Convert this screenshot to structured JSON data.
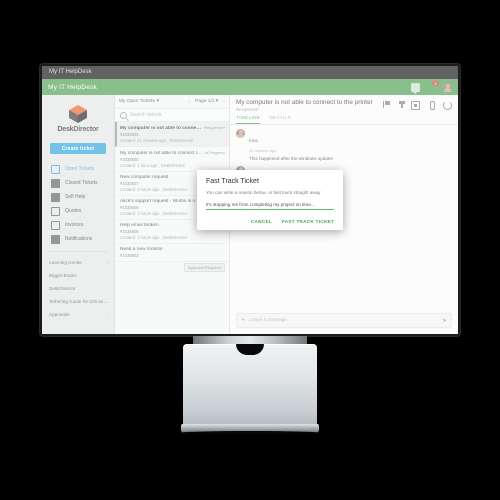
{
  "window": {
    "title": "My IT HelpDesk"
  },
  "topbar": {
    "brand": "My IT HelpDesk",
    "icons": [
      {
        "name": "chat-icon",
        "label": "Chat"
      },
      {
        "name": "bell-icon",
        "label": "Notifications",
        "badge": "3"
      },
      {
        "name": "user-avatar",
        "label": "Account"
      }
    ]
  },
  "sidebar": {
    "logo_name_1": "Desk",
    "logo_name_2": "Director",
    "create_button": "Create ticket",
    "items": [
      {
        "label": "Open Tickets",
        "icon": "inbox-icon",
        "active": true
      },
      {
        "label": "Closed Tickets",
        "icon": "archive-icon",
        "active": false
      },
      {
        "label": "Self Help",
        "icon": "book-icon",
        "active": false
      },
      {
        "label": "Quotes",
        "icon": "card-icon",
        "active": false
      },
      {
        "label": "Invoices",
        "icon": "dollar-icon",
        "active": false
      },
      {
        "label": "Notifications",
        "icon": "bell-icon",
        "active": false
      }
    ],
    "sub_items": [
      {
        "label": "Learning Center",
        "caret": "›"
      },
      {
        "label": "Bigger Brains",
        "caret": ""
      },
      {
        "label": "DeskDirector",
        "caret": ""
      },
      {
        "label": "Tethering Guide for iOS and A...",
        "caret": ""
      },
      {
        "label": "Approvals",
        "caret": "›"
      }
    ]
  },
  "ticket_list": {
    "filter_label": "My Open Tickets",
    "filter_caret": "▾",
    "prev_arrow": "‹",
    "page_label": "Page 1/1",
    "page_caret": "▾",
    "next_arrow": "›",
    "search_placeholder": "Search tickets",
    "items": [
      {
        "title": "My computer is not able to connect to...",
        "status": "ReOpened*",
        "number": "#1035604",
        "meta": "Created: 41 minutes ago , DeskDirector",
        "selected": true
      },
      {
        "title": "My computer is not able to connect to ...",
        "status": "In Progress",
        "number": "#1035600",
        "meta": "Created: 1 hour ago , DeskDirector",
        "selected": false
      },
      {
        "title": "New computer request",
        "status": "",
        "number": "#1035607",
        "meta": "Created: 3 hours ago , DeskDirector",
        "selected": false
      },
      {
        "title": "Alice's support request - Wufoo is n...",
        "status": "",
        "number": "#1035606",
        "meta": "Created: 3 hours ago , DeskDirector",
        "selected": false
      },
      {
        "title": "Help email broken",
        "status": "",
        "number": "#1035605",
        "meta": "Created: 3 hours ago , DeskDirector",
        "selected": false
      },
      {
        "title": "Need a new monitor",
        "status": "",
        "number": "#1035603",
        "meta": "Created: 3 hours ago , DeskDirector",
        "selected": false
      }
    ],
    "approval_chip": "Approval Required"
  },
  "detail": {
    "title": "My computer is not able to connect to the printer",
    "subtitle": "ReOpened*",
    "tools": [
      {
        "name": "flag-icon"
      },
      {
        "name": "pin-icon"
      },
      {
        "name": "archive-icon"
      },
      {
        "name": "attachment-icon"
      },
      {
        "name": "refresh-icon"
      }
    ],
    "tabs": [
      {
        "label": "TIMELINE",
        "active": true
      },
      {
        "label": "DETAILS",
        "active": false
      }
    ],
    "entries": [
      {
        "author": "Irina",
        "time": "41 minutes ago",
        "body": "This happened after the windows update!"
      },
      {
        "author": "Irina",
        "time": "",
        "body": ""
      }
    ],
    "composer_placeholder": "Leave a message",
    "composer_plus": "+",
    "composer_send": "➤"
  },
  "modal": {
    "title": "Fast Track Ticket",
    "description": "You can write a reason below, or fast track straight away",
    "input_value": "It's stopping me from completing my project on time...",
    "cancel_label": "CANCEL",
    "confirm_label": "FAST TRACK TICKET"
  },
  "colors": {
    "brand_green": "#4a9d4f",
    "accent_blue": "#29a3dc",
    "badge_red": "#e03b2f"
  }
}
